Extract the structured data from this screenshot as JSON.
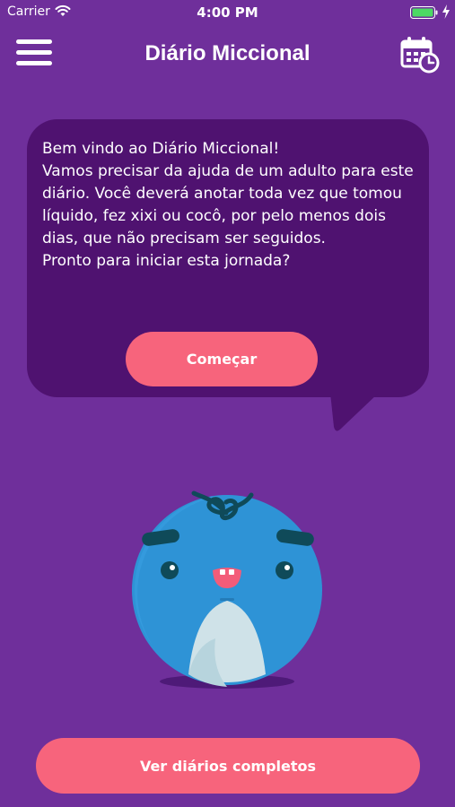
{
  "status_bar": {
    "carrier": "Carrier",
    "time": "4:00 PM"
  },
  "nav": {
    "title": "Diário Miccional",
    "menu_icon": "hamburger-menu-icon",
    "calendar_icon": "calendar-clock-icon"
  },
  "welcome": {
    "lines": [
      "Bem vindo ao Diário Miccional!",
      "Vamos precisar da ajuda de um adulto para este",
      "diário. Você deverá anotar toda vez que tomou",
      "líquido, fez xixi ou cocô, por pelo menos dois",
      "dias, que não precisam ser seguidos.",
      "Pronto para iniciar esta jornada?"
    ],
    "start_label": "Começar"
  },
  "footer": {
    "diaries_label": "Ver diários completos"
  },
  "colors": {
    "background": "#6f2f9b",
    "bubble": "#4f1270",
    "accent": "#f7647c",
    "mascot_blue": "#2e93d6"
  }
}
